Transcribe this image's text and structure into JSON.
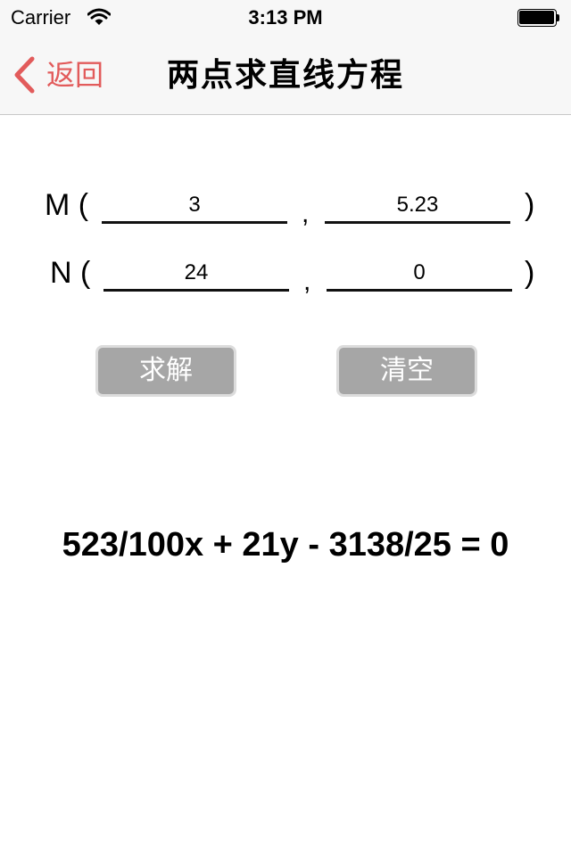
{
  "status_bar": {
    "carrier": "Carrier",
    "time": "3:13 PM",
    "wifi_icon": "wifi-icon",
    "battery_icon": "battery-icon"
  },
  "nav": {
    "back_label": "返回",
    "back_icon": "chevron-left-icon",
    "title": "两点求直线方程",
    "accent_color": "#e25b5b"
  },
  "points": {
    "m": {
      "label": "M (",
      "x": "3",
      "y": "5.23"
    },
    "n": {
      "label": "N (",
      "x": "24",
      "y": "0"
    },
    "comma": ",",
    "close_paren": ")"
  },
  "actions": {
    "solve_label": "求解",
    "clear_label": "清空",
    "button_color": "#a6a6a6"
  },
  "result": {
    "equation": "523/100x + 21y - 3138/25 = 0"
  }
}
